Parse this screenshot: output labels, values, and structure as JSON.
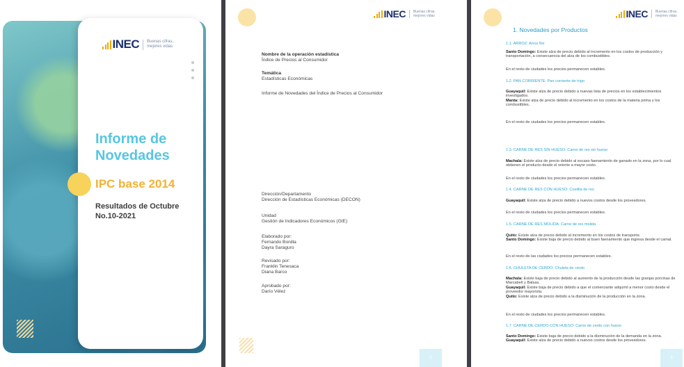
{
  "logo": {
    "word": "INEC",
    "tag_line1": "Buenas cifras,",
    "tag_line2": "mejores vidas"
  },
  "cover": {
    "title_line1": "Informe de",
    "title_line2": "Novedades",
    "ipc": "IPC base 2014",
    "results_line1": "Resultados de Octubre",
    "results_line2": "No.10-2021"
  },
  "page2": {
    "op_label": "Nombre de la operación estadística",
    "op_value": "Índice de Precios al Consumidor",
    "tema_label": "Temática",
    "tema_value": "Estadísticas Económicas",
    "report_title": "Informe de Novedades  del Índice de Precios al Consumidor",
    "dir_label": "Dirección/Departamento",
    "dir_value": "Dirección de Estadísticas Económicas (DECON)",
    "unit_label": "Unidad",
    "unit_value": "Gestión de Indicadores Económicos (GIE)",
    "elab_label": "Elaborado por:",
    "elab_1": "Fernando Bonilla",
    "elab_2": "Dayra Saraguro",
    "rev_label": "Revisado por:",
    "rev_1": "Franklin Tenesaca",
    "rev_2": "Diana Barco",
    "apr_label": "Aprobado por:",
    "apr_1": "Darío Vélez",
    "page_number": "2"
  },
  "page3": {
    "heading": "1.  Novedades por Productos",
    "rest_text": "En el resto de ciudades los precios permanecen estables.",
    "s1": "1.1.    ARROZ: Arroz flor",
    "s1_c1": "Santo Domingo:",
    "s1_t1": " Existe alza de precio debido al incremento en los costos de producción y transportación, a consecuencia del alza de los combustibles.",
    "s2": "1.2.    PAN CORRIENTE: Pan corriente de trigo",
    "s2_c1": "Guayaquil:",
    "s2_t1": " Existe alza de precio debido a nuevas lista de precios en los establecimientos investigados.",
    "s2_c2": "Manta:",
    "s2_t2": " Existe alza de precio debido al incremento en los costos de la materia prima y los combustibles.",
    "s3": "1.3.    CARNE DE RES SIN HUESO: Carne de res sin hueso",
    "s3_c1": "Machala:",
    "s3_t1": " Existe alza de precio debido al escaso faenamiento de ganado en la zona, por lo cual obtienen el producto desde el oriente a mayor costo.",
    "s4": "1.4.    CARNE DE RES CON HUESO: Costilla de res",
    "s4_c1": "Guayaquil:",
    "s4_t1": " Existe alza de precio debido a nuevos costos desde los proveedores.",
    "s5": "1.5.    CARNE DE RES MOLIDA: Carne de res molida",
    "s5_c1": "Quito:",
    "s5_t1": " Existe alza de precio debido al incremento en los costos de transporte.",
    "s5_c2": "Santo Domingo:",
    "s5_t2": " Existe baja de precio debido al buen faenamiento que ingresa desde el camal.",
    "rest_text2": "En el resto de las ciudades los precios permanecen estables.",
    "s6": "1.6.    CHULETA DE CERDO:  Chuleta de cerdo",
    "s6_c1": "Machala:",
    "s6_t1": " Existe baja de precio debido al aumento de la producción desde las granjas porcinas de Marcabelí y Balsas.",
    "s6_c2": "Guayaquil:",
    "s6_t2": " Existe baja de precio debido a que el comerciante adquirió a menor costo desde el proveedor mayorista.",
    "s6_c3": "Quito:",
    "s6_t3": " Existe alza de precio debido a la disminución de la producción en la zona.",
    "s7": "1.7.    CARNE DE CERDO CON HUESO: Carne de cerdo con hueso",
    "s7_c1": "Santo Domingo:",
    "s7_t1": " Existe baja de precio debido a la disminución de la demanda en la zona.",
    "s7_c2": "Guayaquil:",
    "s7_t2": " Existe alza de precio debido a nuevos costos desde los proveedores.",
    "page_number": "3"
  }
}
